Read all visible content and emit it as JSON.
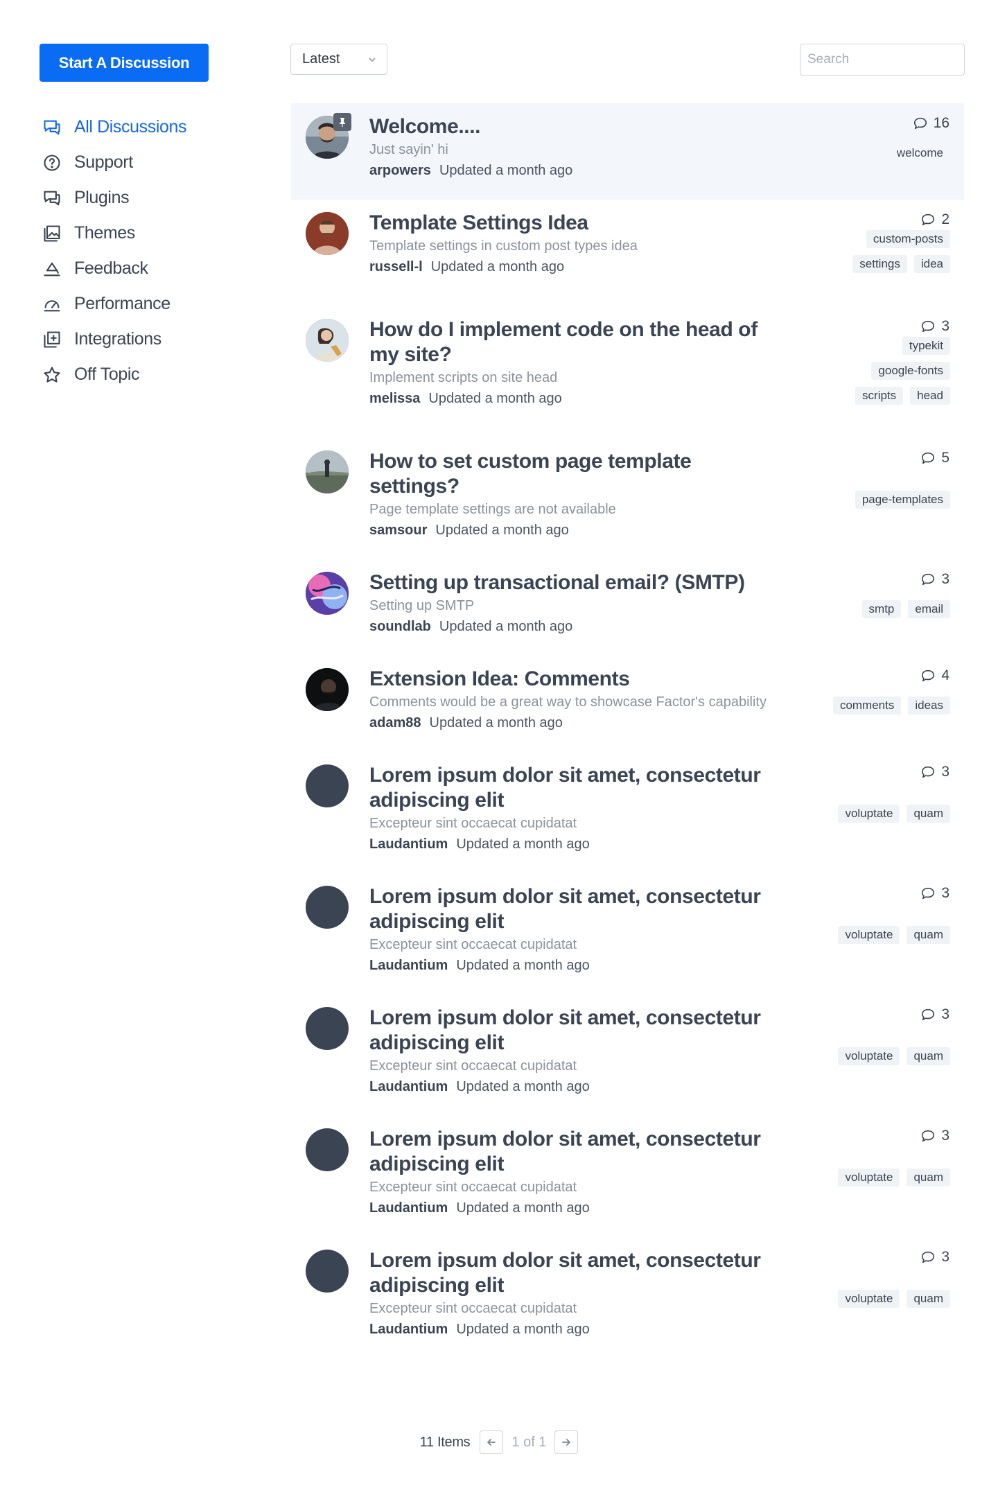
{
  "start_button": "Start A Discussion",
  "sort": {
    "selected": "Latest"
  },
  "search": {
    "placeholder": "Search"
  },
  "nav": [
    {
      "label": "All Discussions",
      "icon": "chat-bubbles-icon",
      "active": true
    },
    {
      "label": "Support",
      "icon": "help-circle-icon"
    },
    {
      "label": "Plugins",
      "icon": "chat-bubbles-icon"
    },
    {
      "label": "Themes",
      "icon": "image-gallery-icon"
    },
    {
      "label": "Feedback",
      "icon": "paint-bucket-icon"
    },
    {
      "label": "Performance",
      "icon": "speedometer-icon"
    },
    {
      "label": "Integrations",
      "icon": "add-stack-icon"
    },
    {
      "label": "Off Topic",
      "icon": "star-icon"
    }
  ],
  "discussions": [
    {
      "title": "Welcome....",
      "excerpt": "Just sayin' hi",
      "author": "arpowers",
      "updated": "Updated a month ago",
      "comments": "16",
      "tags": [
        "welcome"
      ],
      "pinned": true,
      "avatar": "photo-man-beard"
    },
    {
      "title": "Template Settings Idea",
      "excerpt": "Template settings in custom post types idea",
      "author": "russell-l",
      "updated": "Updated a month ago",
      "comments": "2",
      "tags": [
        "custom-posts",
        "settings",
        "idea"
      ],
      "avatar": "photo-man-red"
    },
    {
      "title": "How do I implement code on the head of my site?",
      "excerpt": "Implement scripts on site head",
      "author": "melissa",
      "updated": "Updated a month ago",
      "comments": "3",
      "tags": [
        "typekit",
        "google-fonts",
        "scripts",
        "head"
      ],
      "avatar": "photo-woman"
    },
    {
      "title": "How to set custom page template settings?",
      "excerpt": "Page template settings are not available",
      "author": "samsour",
      "updated": "Updated a month ago",
      "comments": "5",
      "tags": [
        "page-templates"
      ],
      "avatar": "photo-landscape"
    },
    {
      "title": "Setting up transactional email? (SMTP)",
      "excerpt": "Setting up SMTP",
      "author": "soundlab",
      "updated": "Updated a month ago",
      "comments": "3",
      "tags": [
        "smtp",
        "email"
      ],
      "avatar": "photo-abstract"
    },
    {
      "title": "Extension Idea: Comments",
      "excerpt": "Comments would be a great way to showcase Factor's capability",
      "author": "adam88",
      "updated": "Updated a month ago",
      "comments": "4",
      "tags": [
        "comments",
        "ideas"
      ],
      "avatar": "photo-dark"
    },
    {
      "title": "Lorem ipsum dolor sit amet, consectetur adipiscing elit",
      "excerpt": "Excepteur sint occaecat cupidatat",
      "author": "Laudantium",
      "updated": "Updated a month ago",
      "comments": "3",
      "tags": [
        "voluptate",
        "quam"
      ],
      "avatar": "placeholder"
    },
    {
      "title": "Lorem ipsum dolor sit amet, consectetur adipiscing elit",
      "excerpt": "Excepteur sint occaecat cupidatat",
      "author": "Laudantium",
      "updated": "Updated a month ago",
      "comments": "3",
      "tags": [
        "voluptate",
        "quam"
      ],
      "avatar": "placeholder"
    },
    {
      "title": "Lorem ipsum dolor sit amet, consectetur adipiscing elit",
      "excerpt": "Excepteur sint occaecat cupidatat",
      "author": "Laudantium",
      "updated": "Updated a month ago",
      "comments": "3",
      "tags": [
        "voluptate",
        "quam"
      ],
      "avatar": "placeholder"
    },
    {
      "title": "Lorem ipsum dolor sit amet, consectetur adipiscing elit",
      "excerpt": "Excepteur sint occaecat cupidatat",
      "author": "Laudantium",
      "updated": "Updated a month ago",
      "comments": "3",
      "tags": [
        "voluptate",
        "quam"
      ],
      "avatar": "placeholder"
    },
    {
      "title": "Lorem ipsum dolor sit amet, consectetur adipiscing elit",
      "excerpt": "Excepteur sint occaecat cupidatat",
      "author": "Laudantium",
      "updated": "Updated a month ago",
      "comments": "3",
      "tags": [
        "voluptate",
        "quam"
      ],
      "avatar": "placeholder"
    }
  ],
  "pagination": {
    "items": "11 Items",
    "pages": "1 of 1"
  },
  "colors": {
    "accent": "#0a6cf5",
    "text": "#3b4453",
    "muted": "#8b929c",
    "pinned_bg": "#f3f6fa",
    "tag_bg": "#f0f3f6"
  }
}
